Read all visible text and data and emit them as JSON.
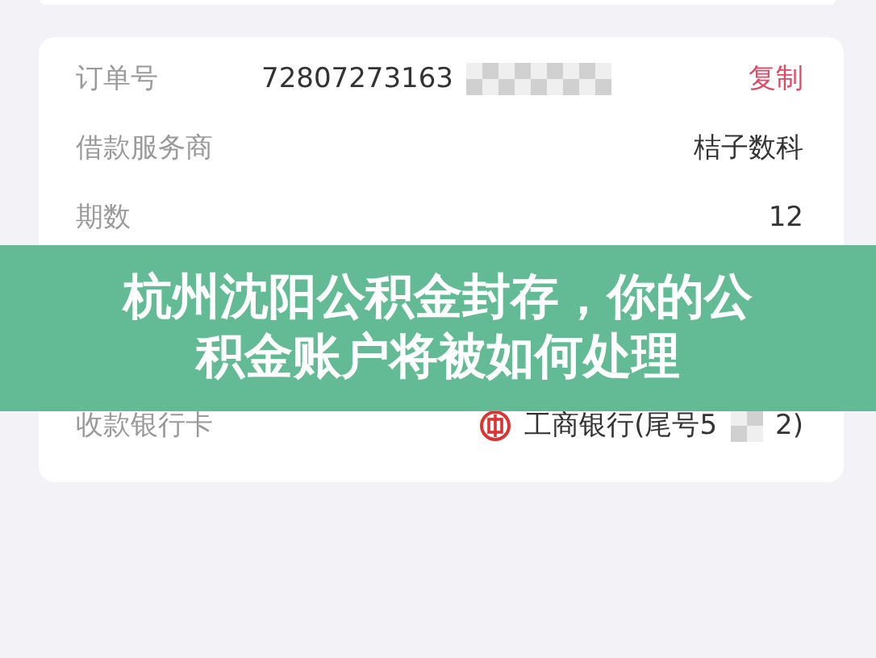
{
  "order_details": {
    "rows": [
      {
        "kind": "copy",
        "label": "订单号",
        "value": "72807273163",
        "masked": true,
        "action": "复制"
      },
      {
        "kind": "text",
        "label": "借款服务商",
        "value": "桔子数科"
      },
      {
        "kind": "text",
        "label": "期数",
        "value": "12"
      },
      {
        "kind": "hidden"
      },
      {
        "kind": "hidden"
      },
      {
        "kind": "bank",
        "label": "收款银行卡",
        "value": "工商银行(尾号5",
        "masked": true,
        "suffix": "2)"
      }
    ]
  },
  "banner": {
    "title": "杭州沈阳公积金封存，你的公积金账户将被如何处理"
  }
}
